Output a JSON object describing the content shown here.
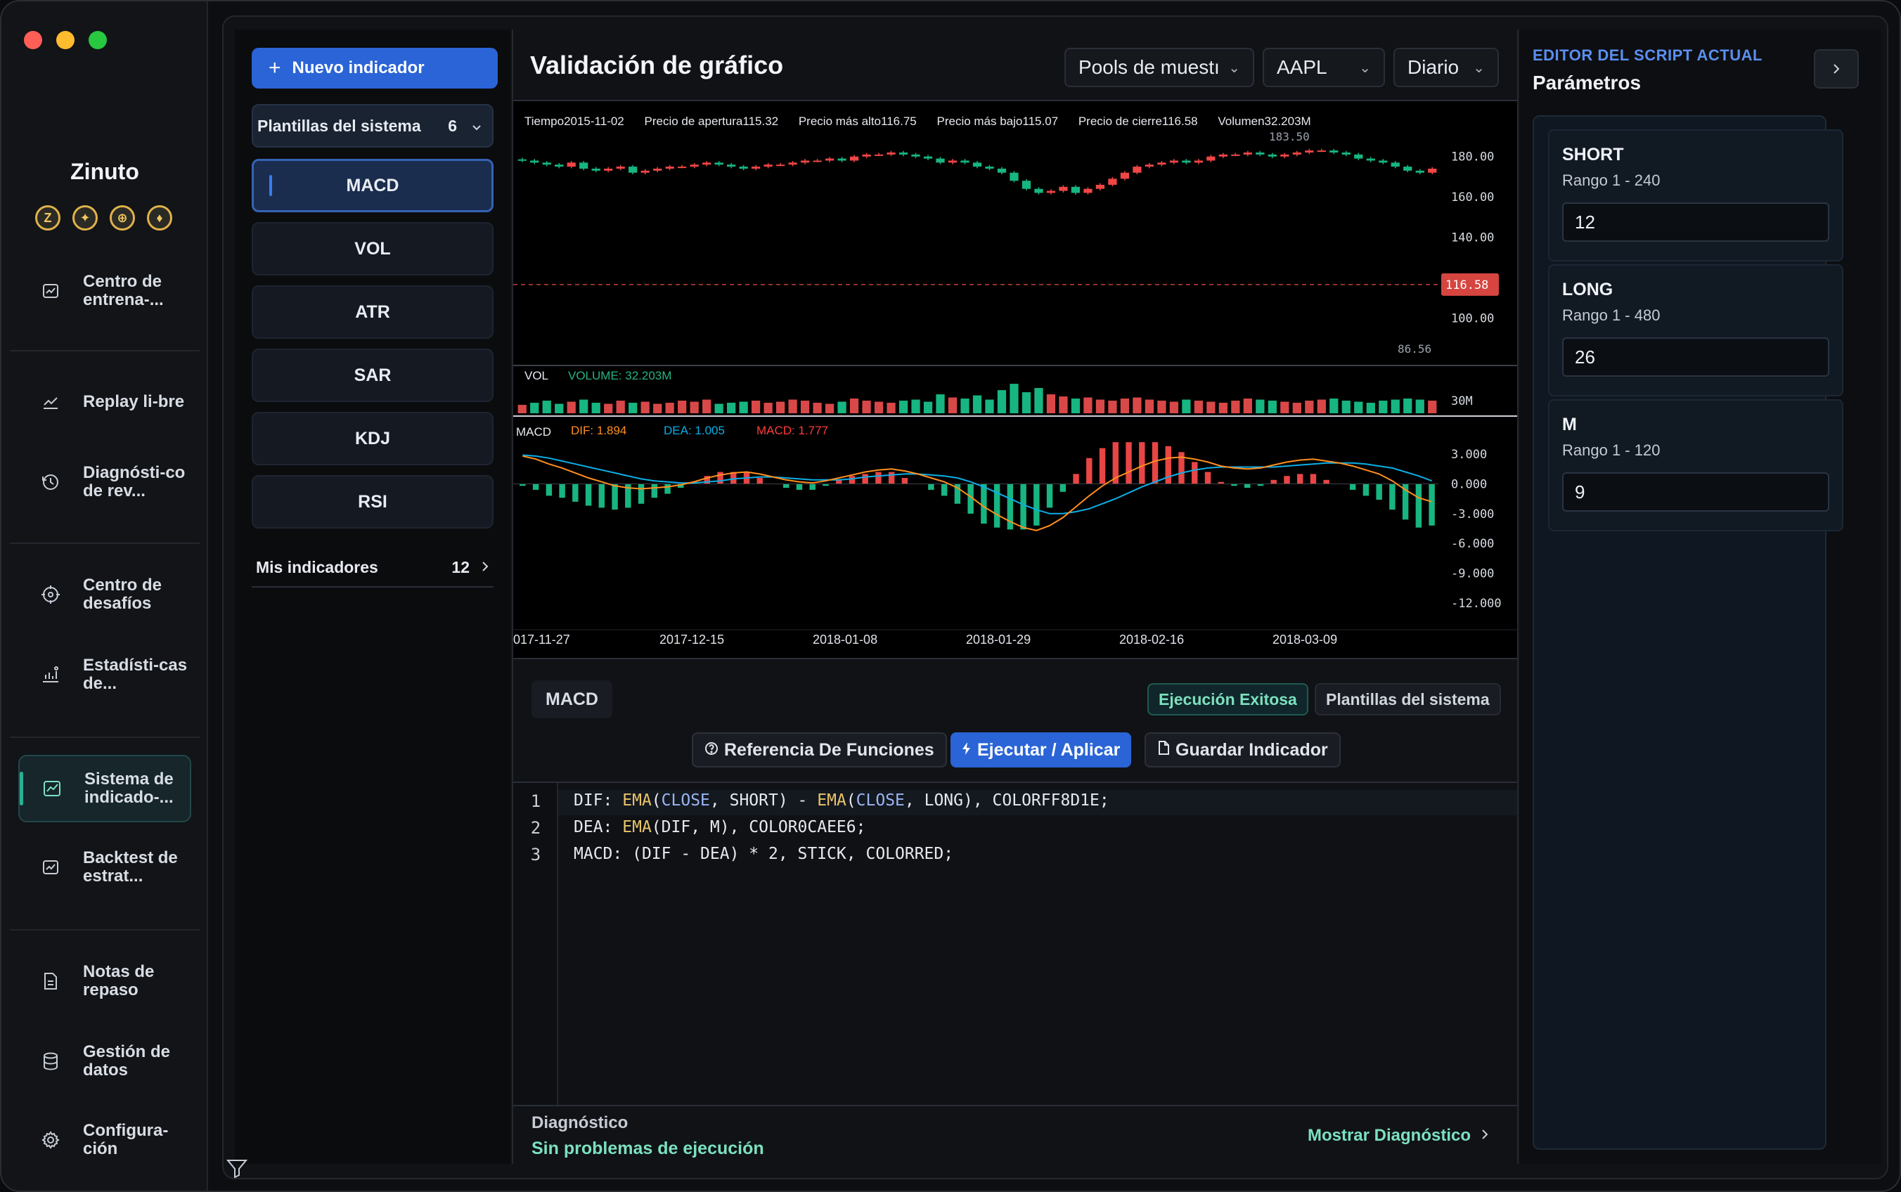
{
  "app": {
    "brand": "Zinuto",
    "coins": [
      "Z",
      "✦",
      "⊕",
      "♦"
    ],
    "traffic_colors": [
      "#ff5f57",
      "#febc2e",
      "#28c840"
    ]
  },
  "sidebar": {
    "items": [
      {
        "label": "Centro de entrena-...",
        "icon": "chart-board-icon"
      },
      {
        "label": "Replay li-bre",
        "icon": "trend-line-icon"
      },
      {
        "label": "Diagnósti-co de rev...",
        "icon": "history-icon"
      },
      {
        "label": "Centro de desafíos",
        "icon": "target-icon"
      },
      {
        "label": "Estadísti-cas de...",
        "icon": "stats-icon"
      },
      {
        "label": "Sistema de indicado-...",
        "icon": "indicator-icon",
        "active": true
      },
      {
        "label": "Backtest de estrat...",
        "icon": "backtest-icon"
      },
      {
        "label": "Notas de repaso",
        "icon": "notes-icon"
      },
      {
        "label": "Gestión de datos",
        "icon": "database-icon"
      },
      {
        "label": "Configura-ción",
        "icon": "gear-icon"
      }
    ]
  },
  "indicators": {
    "new_button": "Nuevo indicador",
    "system_templates_label": "Plantillas del sistema",
    "system_templates_count": "6",
    "items": [
      "MACD",
      "VOL",
      "ATR",
      "SAR",
      "KDJ",
      "RSI"
    ],
    "active": "MACD",
    "my_label": "Mis indicadores",
    "my_count": "12"
  },
  "header": {
    "title": "Validación de gráfico",
    "pool": "Pools de muestı",
    "symbol": "AAPL",
    "period": "Diario"
  },
  "chart_data": {
    "type": "candlestick",
    "info": {
      "time_label": "Tiempo",
      "time": "2015-11-02",
      "open_label": "Precio de apertura",
      "open": "115.32",
      "high_label": "Precio más alto",
      "high": "116.75",
      "low_label": "Precio más bajo",
      "low": "115.07",
      "close_label": "Precio de cierre",
      "close": "116.58",
      "volume_label": "Volumen",
      "volume": "32.203M"
    },
    "price_ticks": [
      "180.00",
      "160.00",
      "140.00",
      "100.00"
    ],
    "price_range": [
      80,
      190
    ],
    "last_price": "116.58",
    "max_label": "183.50",
    "min_label": "86.56",
    "closes": [
      178,
      177,
      176,
      175,
      177,
      174,
      173,
      174,
      175,
      172,
      173,
      174,
      175,
      175,
      176,
      177,
      176,
      175,
      174,
      175,
      176,
      176,
      177,
      178,
      178,
      179,
      178,
      180,
      181,
      181,
      182,
      181,
      180,
      179,
      177,
      178,
      177,
      175,
      174,
      172,
      168,
      164,
      162,
      163,
      165,
      162,
      164,
      166,
      169,
      172,
      175,
      176,
      177,
      178,
      177,
      178,
      180,
      181,
      181,
      182,
      181,
      180,
      181,
      182,
      183,
      183,
      182,
      181,
      179,
      178,
      177,
      175,
      173,
      172,
      174
    ],
    "volume_label": "VOL",
    "volume_text": "VOLUME: 32.203M",
    "volume_tick": "30M",
    "volumes": [
      8,
      10,
      12,
      9,
      11,
      13,
      10,
      9,
      12,
      10,
      11,
      9,
      10,
      12,
      11,
      13,
      9,
      10,
      11,
      12,
      10,
      11,
      13,
      12,
      10,
      9,
      11,
      14,
      12,
      11,
      10,
      12,
      13,
      11,
      18,
      15,
      14,
      17,
      13,
      22,
      28,
      20,
      24,
      18,
      16,
      14,
      15,
      13,
      12,
      14,
      15,
      13,
      12,
      11,
      13,
      12,
      11,
      10,
      12,
      14,
      13,
      12,
      11,
      10,
      12,
      13,
      14,
      12,
      11,
      10,
      12,
      13,
      14,
      13,
      12
    ],
    "macd_label": "MACD",
    "macd_legend": [
      {
        "name": "DIF",
        "value": "1.894",
        "color": "#ff8f1e"
      },
      {
        "name": "DEA",
        "value": "1.005",
        "color": "#0caee6"
      },
      {
        "name": "MACD",
        "value": "1.777",
        "color": "#ff3b3b"
      }
    ],
    "macd_ticks": [
      "3.000",
      "0.000",
      "-3.000",
      "-6.000",
      "-9.000",
      "-12.000"
    ],
    "macd_range": [
      -13,
      4
    ],
    "dif": [
      2.8,
      2.5,
      2.0,
      1.6,
      1.1,
      0.6,
      0.2,
      -0.2,
      -0.4,
      -0.5,
      -0.4,
      -0.3,
      -0.1,
      0.2,
      0.6,
      0.9,
      1.1,
      1.2,
      1.0,
      0.7,
      0.4,
      0.2,
      0.1,
      0.3,
      0.6,
      0.9,
      1.2,
      1.4,
      1.5,
      1.3,
      1.0,
      0.6,
      0.2,
      -0.4,
      -1.3,
      -2.3,
      -3.1,
      -3.8,
      -4.4,
      -4.7,
      -4.2,
      -3.4,
      -2.3,
      -1.2,
      -0.2,
      0.6,
      1.2,
      1.8,
      2.3,
      2.6,
      2.7,
      2.5,
      2.2,
      1.8,
      1.6,
      1.5,
      1.6,
      1.9,
      2.2,
      2.4,
      2.5,
      2.3,
      2.1,
      1.8,
      1.4,
      1.0,
      0.3,
      -0.6,
      -1.4,
      -1.8
    ],
    "dea": [
      2.9,
      2.8,
      2.6,
      2.3,
      2.0,
      1.7,
      1.4,
      1.1,
      0.8,
      0.5,
      0.3,
      0.2,
      0.1,
      0.1,
      0.2,
      0.3,
      0.5,
      0.6,
      0.7,
      0.7,
      0.6,
      0.5,
      0.4,
      0.4,
      0.4,
      0.5,
      0.7,
      0.8,
      0.9,
      1.0,
      1.0,
      0.9,
      0.8,
      0.6,
      0.2,
      -0.3,
      -0.9,
      -1.5,
      -2.1,
      -2.6,
      -3.0,
      -3.0,
      -2.8,
      -2.5,
      -2.0,
      -1.5,
      -0.9,
      -0.3,
      0.2,
      0.7,
      1.1,
      1.4,
      1.6,
      1.7,
      1.7,
      1.7,
      1.7,
      1.7,
      1.8,
      1.9,
      2.0,
      2.1,
      2.1,
      2.1,
      2.0,
      1.8,
      1.6,
      1.2,
      0.8,
      0.3
    ],
    "x_ticks": [
      "017-11-27",
      "2017-12-15",
      "2018-01-08",
      "2018-01-29",
      "2018-02-16",
      "2018-03-09"
    ]
  },
  "editor": {
    "script_name": "MACD",
    "status": "Ejecución Exitosa",
    "templates": "Plantillas del sistema",
    "ref_button": "Referencia De Funciones",
    "run_button": "Ejecutar / Aplicar",
    "save_button": "Guardar Indicador",
    "lines": [
      "DIF: EMA(CLOSE, SHORT) - EMA(CLOSE, LONG), COLORFF8D1E;",
      "DEA: EMA(DIF, M), COLOR0CAEE6;",
      "MACD: (DIF - DEA) * 2, STICK, COLORRED;"
    ]
  },
  "diagnostics": {
    "title": "Diagnóstico",
    "status": "Sin problemas de ejecución",
    "show": "Mostrar Diagnóstico"
  },
  "params": {
    "eyebrow": "EDITOR DEL SCRIPT ACTUAL",
    "title": "Parámetros",
    "items": [
      {
        "name": "SHORT",
        "range": "Rango 1 - 240",
        "value": "12"
      },
      {
        "name": "LONG",
        "range": "Rango 1 - 480",
        "value": "26"
      },
      {
        "name": "M",
        "range": "Rango 1 - 120",
        "value": "9"
      }
    ]
  }
}
